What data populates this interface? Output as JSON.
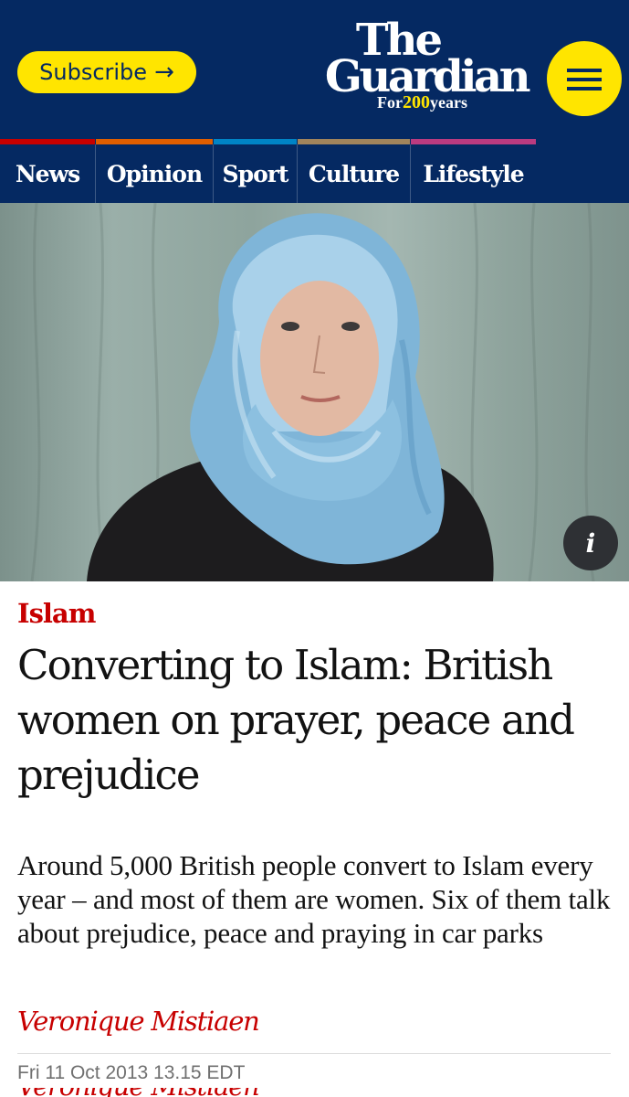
{
  "header": {
    "subscribe_label": "Subscribe",
    "subscribe_arrow": "→",
    "logo": {
      "line1": "The",
      "line2": "Guardian",
      "tagline_pre": "For",
      "tagline_num": "200",
      "tagline_post": "years"
    },
    "menu_icon": "hamburger-menu-icon"
  },
  "nav": {
    "items": [
      {
        "label": "News",
        "color": "#c70000"
      },
      {
        "label": "Opinion",
        "color": "#e05e00"
      },
      {
        "label": "Sport",
        "color": "#0084c6"
      },
      {
        "label": "Culture",
        "color": "#a1845c"
      },
      {
        "label": "Lifestyle",
        "color": "#bb3b80"
      }
    ]
  },
  "hero": {
    "info_icon": "i"
  },
  "article": {
    "kicker": "Islam",
    "headline": "Converting to Islam: British women on prayer, peace and prejudice",
    "standfirst": "Around 5,000 British people convert to Islam every year – and most of them are women. Six of them talk about prejudice, peace and praying in car parks",
    "byline": "Veronique Mistiaen",
    "date": "Fri 11 Oct 2013 13.15 EDT",
    "byline_repeat": "Veronique Mistiaen"
  },
  "colors": {
    "brand": "#052962",
    "accent_yellow": "#ffe500",
    "news_red": "#c70000"
  }
}
